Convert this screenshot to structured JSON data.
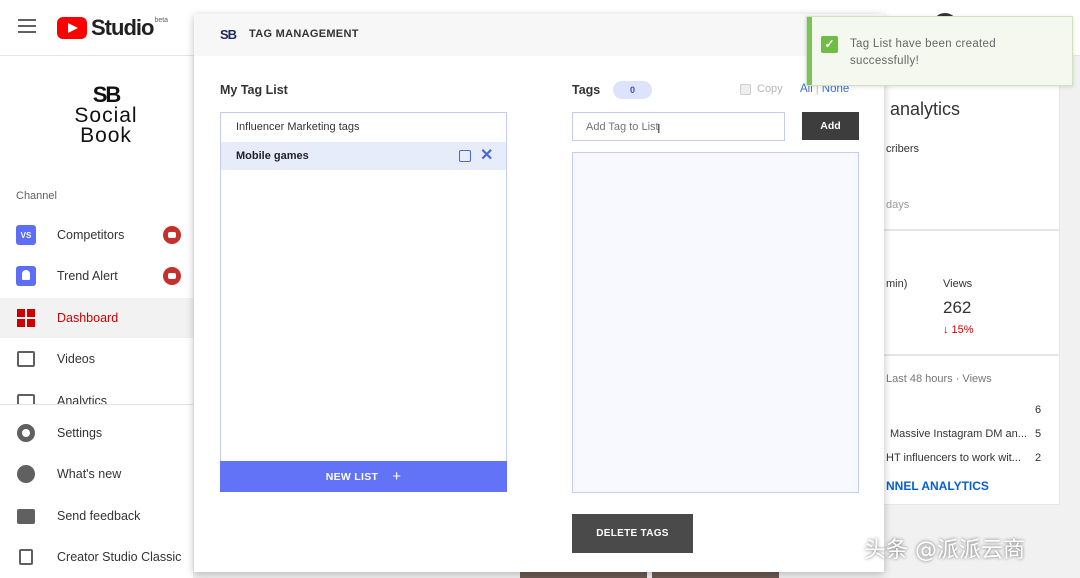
{
  "youtube": {
    "studio_label": "Studio",
    "beta_label": "beta"
  },
  "sidebar": {
    "brand_mark": "SB",
    "brand_line1": "Social",
    "brand_line2": "Book",
    "channel_label": "Channel",
    "items": [
      {
        "label": "Competitors",
        "icon": "vs-icon"
      },
      {
        "label": "Trend Alert",
        "icon": "bell-icon"
      },
      {
        "label": "Dashboard",
        "icon": "dashboard-icon"
      },
      {
        "label": "Videos",
        "icon": "videos-icon"
      },
      {
        "label": "Analytics",
        "icon": "analytics-icon"
      }
    ],
    "bottom_items": [
      {
        "label": "Settings",
        "icon": "gear-icon"
      },
      {
        "label": "What's new",
        "icon": "whats-new-icon"
      },
      {
        "label": "Send feedback",
        "icon": "feedback-icon"
      },
      {
        "label": "Creator Studio Classic",
        "icon": "classic-icon"
      }
    ]
  },
  "background": {
    "analytics_title": "analytics",
    "subscribers_fragment": "cribers",
    "days_fragment": "days",
    "min_fragment": "min)",
    "views_label": "Views",
    "views_value": "262",
    "views_change": "↓ 15%",
    "last48_label": "Last 48 hours · Views",
    "rows": [
      {
        "title": "",
        "value": "6"
      },
      {
        "title": "Massive Instagram DM an...",
        "value": "5"
      },
      {
        "title": "HT influencers to work wit...",
        "value": "2"
      }
    ],
    "channel_analytics_link": "NNEL ANALYTICS"
  },
  "modal": {
    "logo": "SB",
    "title": "TAG MANAGEMENT",
    "my_tag_list_title": "My Tag List",
    "lists": [
      {
        "name": "Influencer Marketing tags",
        "selected": false
      },
      {
        "name": "Mobile games",
        "selected": true
      }
    ],
    "new_list_label": "NEW LIST",
    "tags_title": "Tags",
    "tags_count": "0",
    "copy_label": "Copy",
    "all_label": "All",
    "none_label": "None",
    "add_tag_placeholder": "Add Tag to List",
    "add_button": "Add",
    "delete_button": "DELETE TAGS"
  },
  "toast": {
    "message": "Tag List have been created successfully!",
    "color": "#7cc15b"
  },
  "watermark": "头条 @派派云商",
  "colors": {
    "accent": "#6373f7",
    "link": "#3b6fe0",
    "youtube_red": "#ff0000"
  }
}
